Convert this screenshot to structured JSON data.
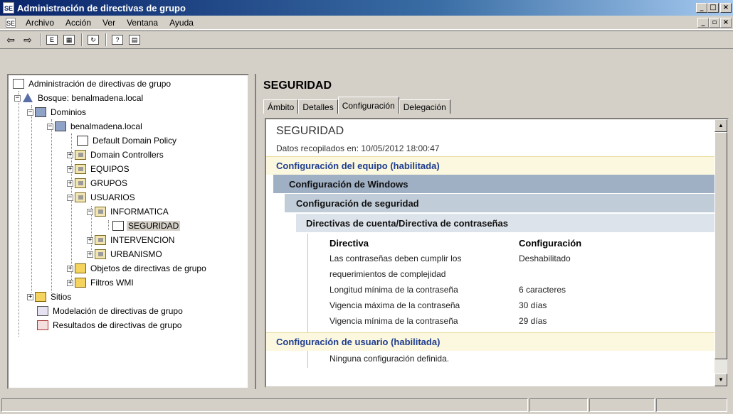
{
  "window": {
    "title": "Administración de directivas de grupo",
    "controls": [
      "_",
      "□",
      "×"
    ]
  },
  "menubar": {
    "items": [
      "Archivo",
      "Acción",
      "Ver",
      "Ventana",
      "Ayuda"
    ],
    "mdi_controls": [
      "_",
      "▫",
      "×"
    ]
  },
  "toolbar": {
    "buttons": [
      {
        "name": "back-icon",
        "glyph": "⇦"
      },
      {
        "name": "forward-icon",
        "glyph": "⇨"
      },
      {
        "name": "up-folder-icon",
        "glyph": "E"
      },
      {
        "name": "show-hide-tree-icon",
        "glyph": "▦"
      },
      {
        "name": "refresh-icon",
        "glyph": "↻"
      },
      {
        "name": "help-icon",
        "glyph": "?"
      },
      {
        "name": "properties-icon",
        "glyph": "▤"
      }
    ]
  },
  "tree": {
    "root": "Administración de directivas de grupo",
    "forest": "Bosque: benalmadena.local",
    "domains": "Dominios",
    "domain": "benalmadena.local",
    "default_policy": "Default Domain Policy",
    "domain_controllers": "Domain Controllers",
    "equipos": "EQUIPOS",
    "grupos": "GRUPOS",
    "usuarios": "USUARIOS",
    "informatica": "INFORMATICA",
    "seguridad": "SEGURIDAD",
    "intervencion": "INTERVENCION",
    "urbanismo": "URBANISMO",
    "gpo_objects": "Objetos de directivas de grupo",
    "wmi_filters": "Filtros WMI",
    "sites": "Sitios",
    "modeling": "Modelación de directivas de grupo",
    "results": "Resultados de directivas de grupo",
    "expanders": {
      "minus": "−",
      "plus": "+"
    }
  },
  "detail": {
    "title": "SEGURIDAD",
    "tabs": [
      "Ámbito",
      "Detalles",
      "Configuración",
      "Delegación"
    ],
    "active_tab": "Configuración",
    "report": {
      "title": "SEGURIDAD",
      "collected": "Datos recopilados en: 10/05/2012 18:00:47",
      "computer_config": "Configuración del equipo (habilitada)",
      "windows_config": "Configuración de Windows",
      "security_config": "Configuración de seguridad",
      "password_policy": "Directivas de cuenta/Directiva de contraseñas",
      "col_policy": "Directiva",
      "col_setting": "Configuración",
      "rows": [
        {
          "policy_l1": "Las contraseñas deben cumplir los",
          "policy_l2": "requerimientos de complejidad",
          "setting": "Deshabilitado"
        },
        {
          "policy_l1": "Longitud mínima de la contraseña",
          "setting": "6 caracteres"
        },
        {
          "policy_l1": "Vigencia máxima de la contraseña",
          "setting": "30 días"
        },
        {
          "policy_l1": "Vigencia mínima de la contraseña",
          "setting": "29 días"
        }
      ],
      "user_config": "Configuración de usuario (habilitada)",
      "user_none": "Ninguna configuración definida."
    }
  },
  "colors": {
    "titlebar_start": "#0a246a",
    "link_blue": "#1f3e8f",
    "band_yellow": "#fcf7df"
  }
}
